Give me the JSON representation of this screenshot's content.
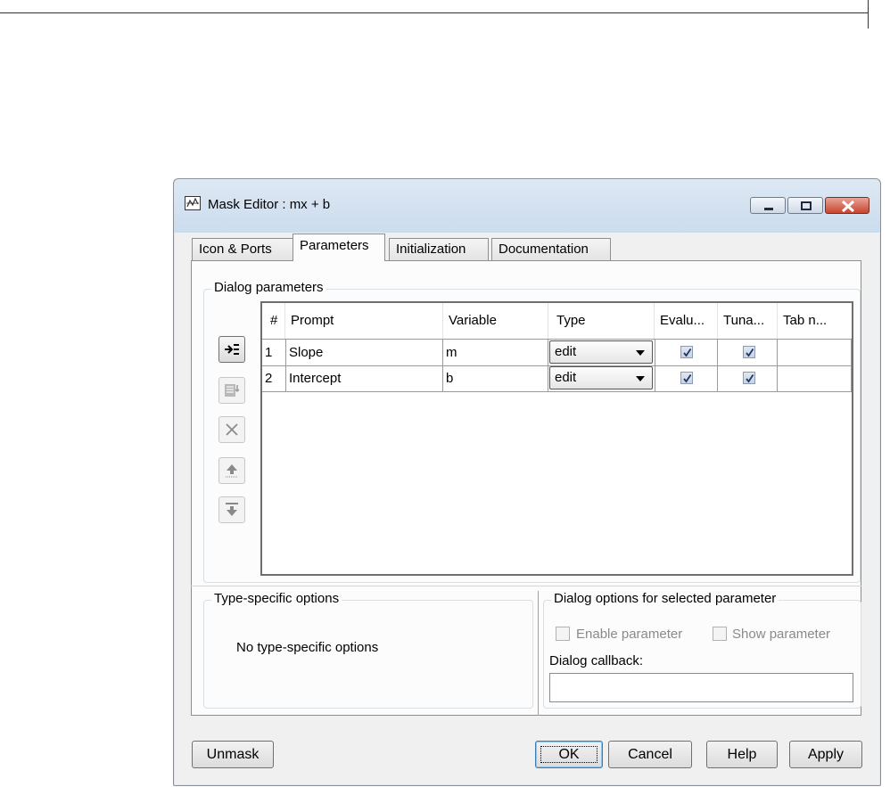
{
  "window": {
    "title": "Mask Editor : mx + b",
    "icon": "mask-editor-icon"
  },
  "tabs": [
    {
      "label": "Icon & Ports",
      "active": false
    },
    {
      "label": "Parameters",
      "active": true
    },
    {
      "label": "Initialization",
      "active": false
    },
    {
      "label": "Documentation",
      "active": false
    }
  ],
  "dialog_parameters": {
    "group_label": "Dialog parameters",
    "side_buttons": [
      {
        "icon": "add-parameter-icon",
        "enabled": true
      },
      {
        "icon": "insert-parameter-icon",
        "enabled": false
      },
      {
        "icon": "delete-icon",
        "enabled": false
      },
      {
        "icon": "move-up-icon",
        "enabled": false
      },
      {
        "icon": "move-down-icon",
        "enabled": false
      }
    ],
    "columns": [
      "#",
      "Prompt",
      "Variable",
      "Type",
      "Evalu...",
      "Tuna...",
      "Tab n..."
    ],
    "rows": [
      {
        "num": "1",
        "prompt": "Slope",
        "variable": "m",
        "type": "edit",
        "evaluate": true,
        "tunable": true,
        "tab": ""
      },
      {
        "num": "2",
        "prompt": "Intercept",
        "variable": "b",
        "type": "edit",
        "evaluate": true,
        "tunable": true,
        "tab": ""
      }
    ]
  },
  "type_specific": {
    "group_label": "Type-specific options",
    "message": "No type-specific options"
  },
  "dialog_options": {
    "group_label": "Dialog options for selected parameter",
    "enable_parameter": "Enable parameter",
    "show_parameter": "Show parameter",
    "callback_label": "Dialog callback:",
    "callback_value": ""
  },
  "buttons": {
    "unmask": "Unmask",
    "ok": "OK",
    "cancel": "Cancel",
    "help": "Help",
    "apply": "Apply"
  },
  "colors": {
    "titlebar": "#cbdcee",
    "close_button": "#c8442e",
    "checkbox_fill": "#c6d2e8",
    "default_button_border": "#3c7fb1"
  }
}
